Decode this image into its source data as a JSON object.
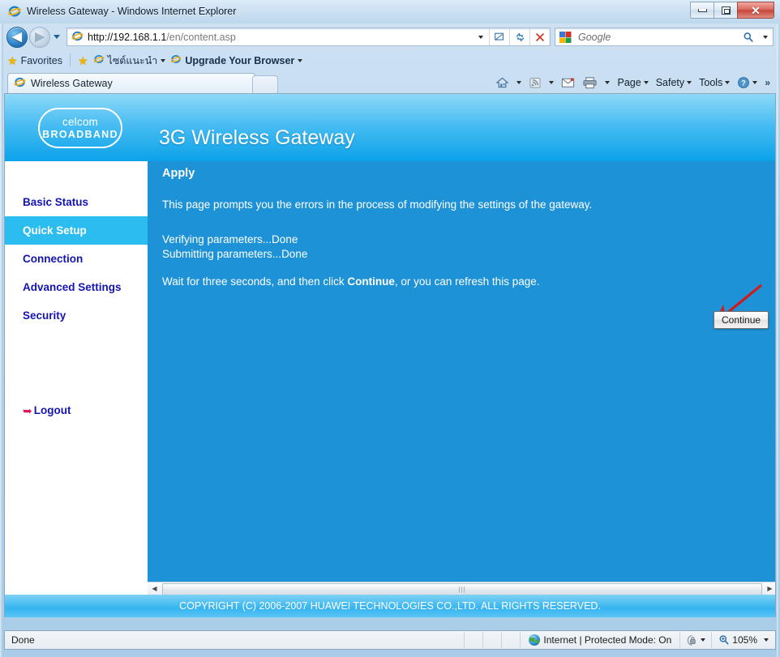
{
  "window": {
    "title": "Wireless Gateway - Windows Internet Explorer",
    "controls": {
      "minimize": "minimize-button",
      "maximize": "restore-button",
      "close": "✕"
    }
  },
  "toolbar": {
    "back": "◀",
    "forward": "▶",
    "address_value": "http://192.168.1.1/en/content.asp",
    "address_host": "http://192.168.1.1",
    "address_path": "/en/content.asp",
    "search_placeholder": "Google",
    "search_value": "",
    "compat_icon": "compatibility-view-icon",
    "refresh_icon": "↯",
    "stop_icon": "✕"
  },
  "favorites": {
    "label": "Favorites",
    "items": [
      {
        "label": "ไซต์แนะนำ",
        "has_caret": true
      },
      {
        "label": "Upgrade Your Browser",
        "has_caret": true,
        "bold": true
      }
    ]
  },
  "tabs": [
    {
      "label": "Wireless Gateway",
      "active": true
    }
  ],
  "command_bar": {
    "items": [
      {
        "label": "",
        "icon": "home-icon",
        "caret": true
      },
      {
        "label": "",
        "icon": "feeds-icon",
        "caret": true
      },
      {
        "label": "",
        "icon": "mail-icon",
        "caret": false
      },
      {
        "label": "",
        "icon": "print-icon",
        "caret": true
      },
      {
        "label": "Page",
        "icon": "",
        "caret": true
      },
      {
        "label": "Safety",
        "icon": "",
        "caret": true
      },
      {
        "label": "Tools",
        "icon": "",
        "caret": true
      },
      {
        "label": "",
        "icon": "help-icon",
        "caret": true
      }
    ],
    "overflow": "»"
  },
  "page": {
    "logo_top": "celcom",
    "logo_bottom": "BROADBAND",
    "title": "3G Wireless Gateway",
    "sidebar": [
      {
        "label": "Basic Status",
        "active": false
      },
      {
        "label": "Quick Setup",
        "active": true
      },
      {
        "label": "Connection",
        "active": false
      },
      {
        "label": "Advanced Settings",
        "active": false
      },
      {
        "label": "Security",
        "active": false
      }
    ],
    "logout_label": "Logout",
    "content": {
      "heading": "Apply",
      "paragraph1": "This page prompts you the errors in the process of modifying the settings of the gateway.",
      "line1": "Verifying parameters...Done",
      "line2": "Submitting parameters...Done",
      "paragraph2_before": "Wait for three seconds, and then click ",
      "paragraph2_bold": "Continue",
      "paragraph2_after": ", or you can refresh this page.",
      "continue_button": "Continue"
    },
    "footer": "COPYRIGHT (C) 2006-2007 HUAWEI TECHNOLOGIES CO.,LTD. ALL RIGHTS RESERVED."
  },
  "statusbar": {
    "status": "Done",
    "zone": "Internet | Protected Mode: On",
    "zoom": "105%"
  },
  "colors": {
    "content_blue": "#1e92d6",
    "accent_cyan": "#2bbdf0",
    "nav_text": "#1414b4",
    "annotation_red": "#d11a1a",
    "logout_pink": "#e0195f"
  }
}
